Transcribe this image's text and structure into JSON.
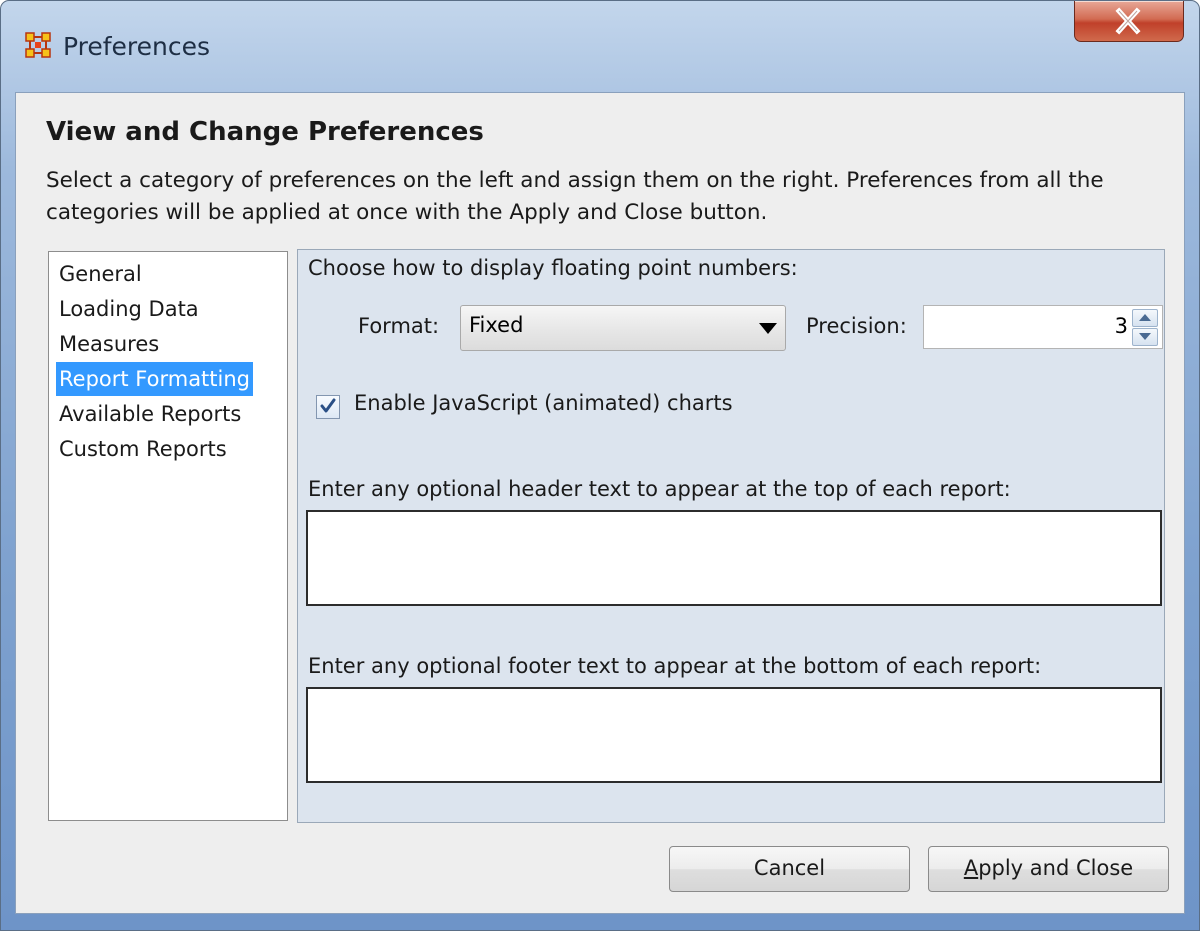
{
  "window": {
    "title": "Preferences",
    "icon": "network-grid-icon"
  },
  "header": {
    "heading": "View and Change Preferences",
    "description": "Select a category of preferences on the left and assign them on the right. Preferences from all the categories will be applied at once with the Apply and Close button."
  },
  "categories": {
    "items": [
      {
        "label": "General",
        "selected": false
      },
      {
        "label": "Loading Data",
        "selected": false
      },
      {
        "label": "Measures",
        "selected": false
      },
      {
        "label": "Report Formatting",
        "selected": true
      },
      {
        "label": "Available Reports",
        "selected": false
      },
      {
        "label": "Custom Reports",
        "selected": false
      }
    ]
  },
  "report_formatting": {
    "floating_label": "Choose how to display floating point numbers:",
    "format_label": "Format:",
    "format_value": "Fixed",
    "precision_label": "Precision:",
    "precision_value": "3",
    "js_charts_label": "Enable JavaScript (animated) charts",
    "js_charts_checked": true,
    "header_text_label": "Enter any optional header text to appear at the top of each report:",
    "header_text_value": "",
    "footer_text_label": "Enter any optional footer text to appear at the bottom of each report:",
    "footer_text_value": ""
  },
  "buttons": {
    "cancel": "Cancel",
    "apply_close_mnemonic": "A",
    "apply_close_rest": "pply and Close"
  },
  "colors": {
    "selection": "#3399ff",
    "panel_bg": "#dce4ee",
    "client_bg": "#eeeeee"
  }
}
